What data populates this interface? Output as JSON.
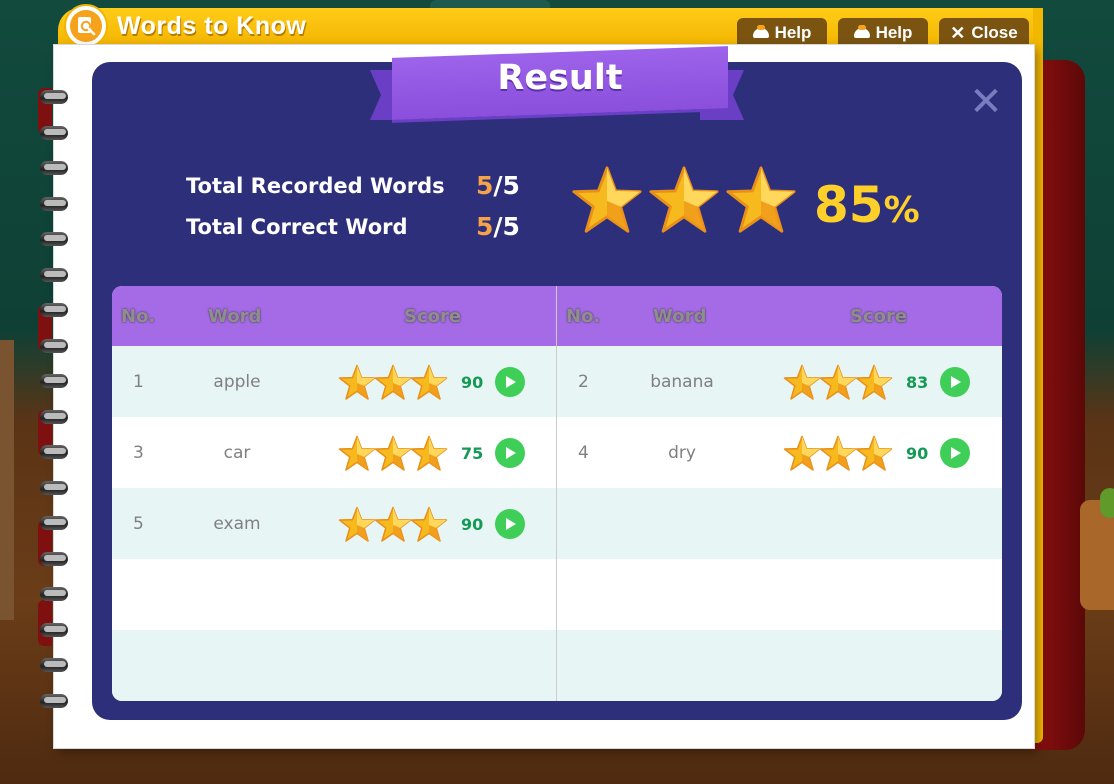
{
  "window": {
    "title": "Words to Know",
    "help_label_1": "Help",
    "help_label_2": "Help",
    "close_label": "Close"
  },
  "result": {
    "banner": "Result",
    "close_icon": "close-x-icon",
    "total_recorded_label": "Total Recorded Words",
    "total_recorded_num": "5",
    "total_recorded_den": "/5",
    "total_correct_label": "Total Correct Word",
    "total_correct_num": "5",
    "total_correct_den": "/5",
    "star_rating": 3,
    "star_max": 3,
    "percent": "85",
    "percent_unit": "%"
  },
  "table": {
    "headers": {
      "no": "No.",
      "word": "Word",
      "score": "Score"
    },
    "rows": [
      {
        "no": "1",
        "word": "apple",
        "score": "90",
        "stars": 3
      },
      {
        "no": "2",
        "word": "banana",
        "score": "83",
        "stars": 3
      },
      {
        "no": "3",
        "word": "car",
        "score": "75",
        "stars": 3
      },
      {
        "no": "4",
        "word": "dry",
        "score": "90",
        "stars": 3
      },
      {
        "no": "5",
        "word": "exam",
        "score": "90",
        "stars": 3
      }
    ]
  },
  "colors": {
    "title_bar": "#f2b400",
    "dialog_bg": "#2d2f7a",
    "banner": "#8a4fdc",
    "header_purple": "#a56ae6",
    "score_green": "#159a55",
    "play_green": "#3fcf58",
    "percent_yellow": "#ffd02a",
    "fraction_orange": "#f6a24a"
  }
}
